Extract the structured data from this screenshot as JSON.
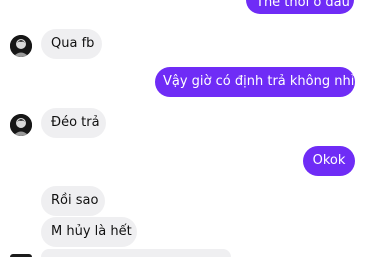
{
  "messages": [
    {
      "direction": "outgoing",
      "text": "Thế thôi ở đâu"
    },
    {
      "direction": "incoming",
      "text": "Qua fb",
      "avatar": true
    },
    {
      "direction": "outgoing",
      "text": "Vậy giờ có định trả không nhỉ"
    },
    {
      "direction": "incoming",
      "text": "Đéo trả",
      "avatar": true
    },
    {
      "direction": "outgoing",
      "text": "Okok"
    },
    {
      "direction": "incoming",
      "text": "Rồi sao"
    },
    {
      "direction": "incoming",
      "text": "M hủy là hết"
    }
  ],
  "icons": {
    "contact_avatar": "profile-photo-icon"
  }
}
